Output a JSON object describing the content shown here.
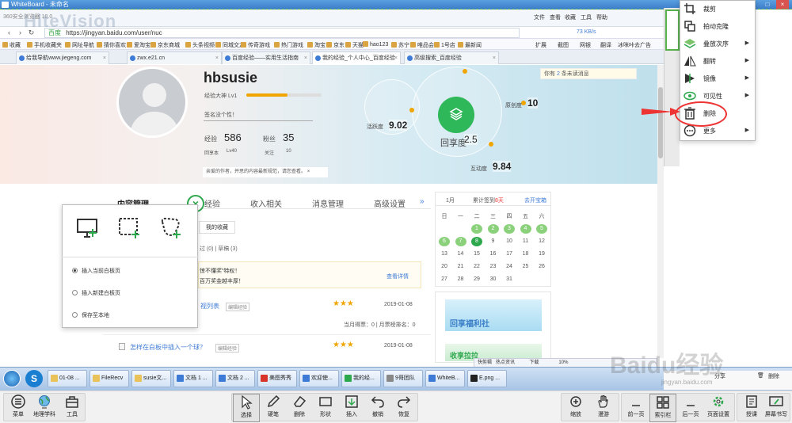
{
  "window": {
    "title": "WhiteBoard - 未命名",
    "controls": [
      "-",
      "□",
      "×"
    ]
  },
  "browser": {
    "name": "360安全浏览器 10.0",
    "watermark": "HiteVision",
    "top_menu": [
      "文件",
      "查看",
      "收藏",
      "工具",
      "帮助"
    ],
    "url": "https://jingyan.baidu.com/user/nuc",
    "secure_label": "百度",
    "speed": "73 KB/s",
    "bookmarks": [
      "收藏",
      "手机收藏夹",
      "网址导航",
      "猜你喜欢",
      "爱淘宝",
      "京东商城",
      "头条视频",
      "同城交友",
      "传奇游戏",
      "热门游戏",
      "淘宝",
      "京东",
      "天猫",
      "hao123",
      "苏宁",
      "唯品会",
      "1号店",
      "最新闻"
    ],
    "bookmark_right": [
      "扩展",
      "截图",
      "网银",
      "翻译",
      "冰咪咔去广告"
    ],
    "tabs": [
      "给我导航www.jiegeng.com",
      "zwx.e21.cn",
      "百度经验——实用生活指南",
      "我的经验_个人中心_百度经验",
      "高级搜索_百度经验"
    ],
    "active_tab": 3
  },
  "profile": {
    "username": "hbsusie",
    "level_label": "经验大神 Lv1",
    "level_progress": 0.55,
    "signature": "签名没个性！",
    "exp_label": "经验",
    "exp_value": "586",
    "fans_label": "粉丝",
    "fans_value": "35",
    "rank_label": "回享本",
    "rank_value": "Lv40",
    "follow_label": "关注",
    "follow_value": "10",
    "notice": "亲爱的作者，并思的内容最新规范，请您查看。",
    "message_prefix": "你有",
    "message_count": "2",
    "message_suffix": "条未读消息"
  },
  "scores": {
    "activity_label": "活跃度",
    "activity_value": "9.02",
    "share_label": "回享度",
    "share_value": "2.5",
    "originality_label": "原创度",
    "originality_value": "10",
    "interaction_label": "互动度",
    "interaction_value": "9.84"
  },
  "page_tabs": [
    "内容管理",
    "经验",
    "收入相关",
    "消息管理",
    "高级设置"
  ],
  "sub_tabs": {
    "favorites": "我的收藏",
    "secondary": "过 (0) | 草稿 (3)"
  },
  "promo": {
    "line1": "惊不懂奖”特权！",
    "line2": "百万奖金越丰厚！",
    "link": "查看详情"
  },
  "rows": [
    {
      "title": "视列表",
      "edit": "编辑经验",
      "stars": "★★★",
      "date": "2019-01-08",
      "meta": "当月得票：0 | 月票榜排名：0"
    },
    {
      "title": "怎样在白板中插入一个球？",
      "edit": "编辑经验",
      "stars": "★★★",
      "date": "2019-01-08"
    }
  ],
  "calendar": {
    "month": "1月",
    "signin_prefix": "累计签到",
    "signin_days": "8天",
    "treasure": "去开宝箱",
    "weekdays": [
      "日",
      "一",
      "二",
      "三",
      "四",
      "五",
      "六"
    ],
    "days": [
      [
        "",
        "",
        "1",
        "2",
        "3",
        "4",
        "5"
      ],
      [
        "6",
        "7",
        "8",
        "9",
        "10",
        "11",
        "12"
      ],
      [
        "13",
        "14",
        "15",
        "16",
        "17",
        "18",
        "19"
      ],
      [
        "20",
        "21",
        "22",
        "23",
        "24",
        "25",
        "26"
      ],
      [
        "27",
        "28",
        "29",
        "30",
        "31",
        "",
        ""
      ]
    ],
    "signed": [
      "1",
      "2",
      "3",
      "4",
      "5",
      "6",
      "7"
    ],
    "today": "8"
  },
  "ads": {
    "ad1": "回享福利社",
    "ad2": "收享拉拉"
  },
  "capture_popup": {
    "options": [
      "插入当前白板页",
      "插入新建白板页",
      "保存至本地"
    ],
    "selected": 0
  },
  "context_menu": {
    "items": [
      {
        "label": "裁剪",
        "icon": "crop-icon",
        "submenu": false
      },
      {
        "label": "拍动克隆",
        "icon": "clone-icon",
        "submenu": false
      },
      {
        "label": "叠放次序",
        "icon": "layer-order-icon",
        "submenu": true
      },
      {
        "label": "翻转",
        "icon": "flip-icon",
        "submenu": true
      },
      {
        "label": "镜像",
        "icon": "mirror-icon",
        "submenu": true
      },
      {
        "label": "可见性",
        "icon": "eye-icon",
        "submenu": true
      },
      {
        "label": "删除",
        "icon": "trash-icon",
        "submenu": false
      },
      {
        "label": "更多",
        "icon": "more-icon",
        "submenu": true
      }
    ]
  },
  "taskbar": {
    "items": [
      "01-08 ...",
      "FileRecv",
      "susie文...",
      "文档 1 ...",
      "文档 2 ...",
      "美图秀秀",
      "欢迎使...",
      "我的经...",
      "9哥团队",
      "WhiteB...",
      "E.png ..."
    ],
    "tray": [
      "快剪辑",
      "热点资讯",
      "下载",
      "10%"
    ]
  },
  "wb_right": {
    "share": "分享",
    "delete": "删除"
  },
  "toolbar": {
    "left": [
      "菜单",
      "地理学科",
      "工具"
    ],
    "center": [
      "选择",
      "硬笔",
      "删除",
      "形状",
      "插入",
      "撤销",
      "恢复"
    ],
    "right1": [
      "缩放",
      "漫游"
    ],
    "right2": [
      "前一页",
      "索引栏",
      "后一页",
      "页面设置"
    ],
    "right3": [
      "授课",
      "屏幕书写"
    ]
  },
  "baidu_watermark": {
    "logo": "Baidu经验",
    "url": "jingyan.baidu.com"
  },
  "colors": {
    "accent_green": "#2ea84d",
    "highlight_red": "#e33333",
    "banner_blue": "#bfe0ec"
  }
}
